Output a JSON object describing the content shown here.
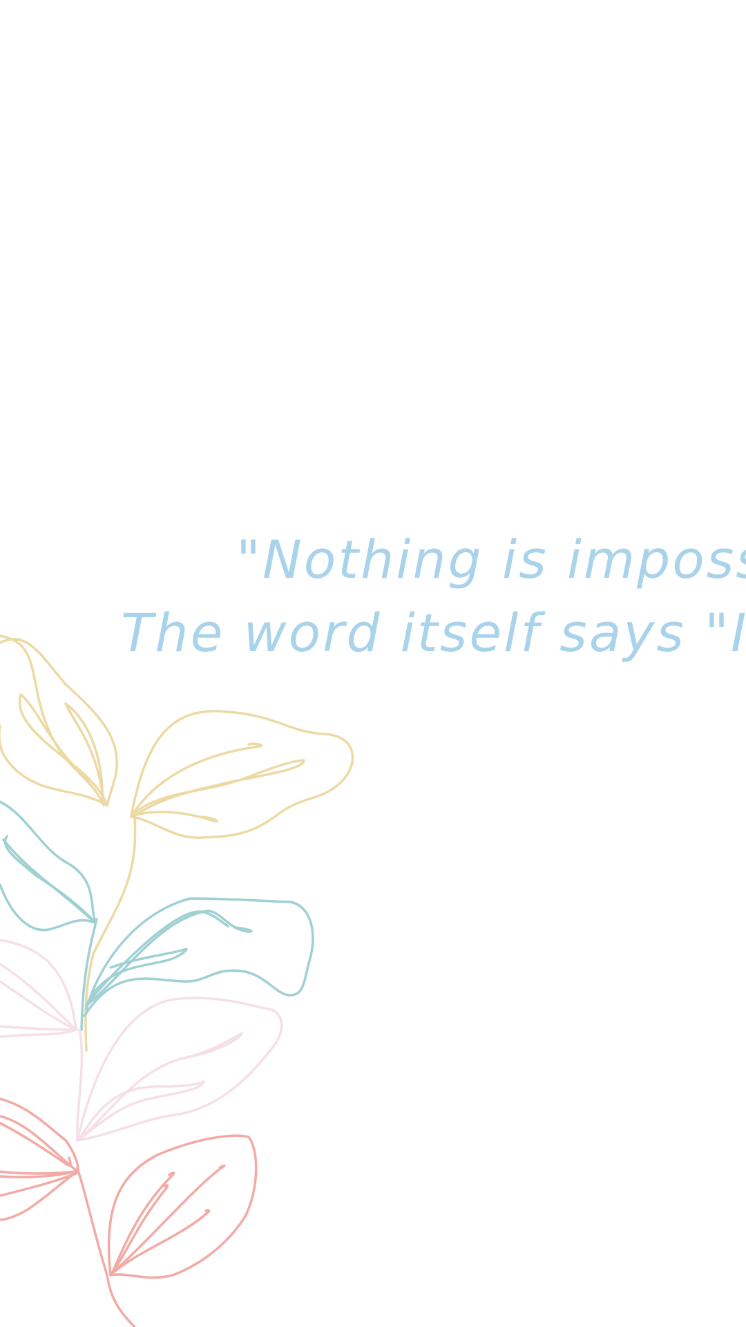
{
  "quote": {
    "line1": "\"Nothing is impossible.",
    "line2": "The word itself says \"I'm pos",
    "color": "#a9d3ea"
  },
  "illustration": {
    "name": "line-art-leaf-branch",
    "colors": {
      "yellow": "#ecd9a3",
      "teal": "#9fd0d3",
      "pink": "#f5dfe8",
      "coral": "#f3aaa4"
    }
  }
}
